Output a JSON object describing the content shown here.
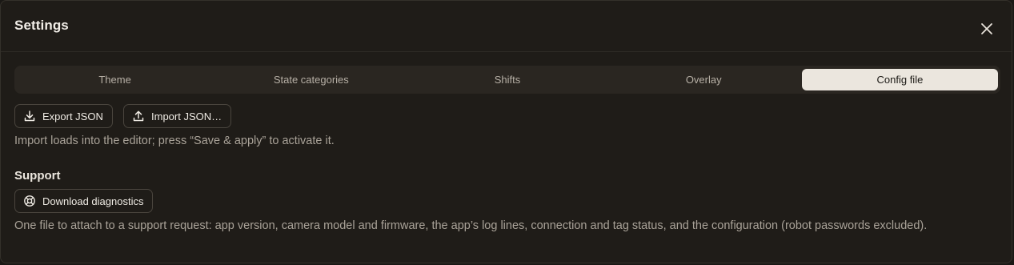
{
  "dialog": {
    "title": "Settings"
  },
  "tabs": [
    {
      "label": "Theme",
      "active": false
    },
    {
      "label": "State categories",
      "active": false
    },
    {
      "label": "Shifts",
      "active": false
    },
    {
      "label": "Overlay",
      "active": false
    },
    {
      "label": "Config file",
      "active": true
    }
  ],
  "config": {
    "export_label": "Export JSON",
    "import_label": "Import JSON…",
    "hint": "Import loads into the editor; press “Save & apply” to activate it."
  },
  "support": {
    "title": "Support",
    "diagnostics_label": "Download diagnostics",
    "description": "One file to attach to a support request: app version, camera model and firmware, the app’s log lines, connection and tag status, and the configuration (robot passwords excluded)."
  },
  "colors": {
    "background": "#1f1c18",
    "tab_bar": "#2a2621",
    "active_tab": "#ebe6de",
    "text": "#e9e4dc",
    "muted_text": "#a9a298"
  }
}
